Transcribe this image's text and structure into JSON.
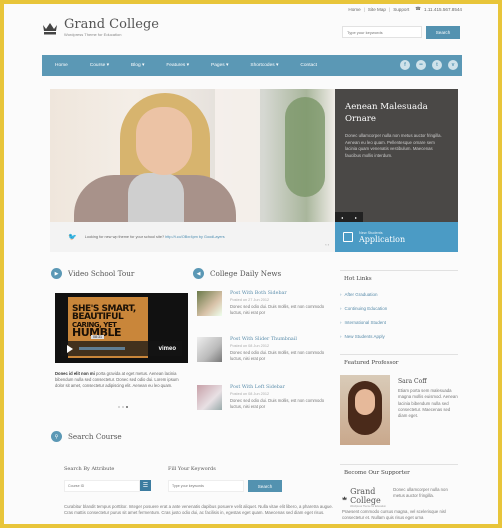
{
  "topbar": {
    "links": [
      "Home",
      "Site Map",
      "Support"
    ],
    "phone": "1.11.415.567.8544"
  },
  "logo": {
    "name": "Grand College",
    "tagline": "Wordpress Theme for Education"
  },
  "header_search": {
    "placeholder": "Type your keywords",
    "button": "Search"
  },
  "nav": {
    "items": [
      "Home",
      "Course ▾",
      "Blog ▾",
      "Features ▾",
      "Pages ▾",
      "Shortcodes ▾",
      "Contact"
    ],
    "social": [
      "facebook-icon",
      "flickr-icon",
      "twitter-icon",
      "vimeo-icon"
    ]
  },
  "slider": {
    "caption_title": "Aenean Malesuada Ornare",
    "caption_text": "Donec ullamcorper nulla non metus auctor fringilla. Aenean eu leo quam. Pellentesque ornare sem lacinia quam venenatis vestibulum. Maecenas faucibus mollis interdum.",
    "prev": "◂",
    "next": "▸"
  },
  "apply": {
    "small": "New Students",
    "big": "Application"
  },
  "tweet": {
    "text": "Looking for new wp theme for your school site?",
    "link": "http://t.co/OBxr4pm",
    "by": "by GoodLayers",
    "pager": "‹ ›"
  },
  "video_section": {
    "title": "Video School Tour",
    "screen_lines": [
      "SHE'S SMART,",
      "BEAUTIFUL",
      "CARING, YET",
      "HUMBLE"
    ],
    "time": "08:31",
    "brand": "vimeo",
    "text_bold": "Donec id elit non mi",
    "text": " porta gravida at eget metus. Aenean lacinia bibendum nulla sed consectetur. Donec sed odio dui. Lorem ipsum dolor sit amet, consectetur adipiscing elit. Aenean eu leo quam."
  },
  "news_section": {
    "title": "College Daily News",
    "posts": [
      {
        "title": "Post With Both Sidebar",
        "date": "Posted on 27 Jun 2012",
        "excerpt": "Donec sed odio dui. Duis mollis, est non commodo luctus, nisi erat por"
      },
      {
        "title": "Post With Slider Thumbnail",
        "date": "Posted on 08 Jun 2012",
        "excerpt": "Donec sed odio dui. Duis mollis, est non commodo luctus, nisi erat por"
      },
      {
        "title": "Post With Left Sidebar",
        "date": "Posted on 08 Jun 2012",
        "excerpt": "Donec sed odio dui. Duis mollis, est non commodo luctus, nisi erat por"
      }
    ]
  },
  "hot_links": {
    "title": "Hot Links",
    "items": [
      "After Graduation",
      "Continuing Education",
      "International Student",
      "New Students Apply"
    ]
  },
  "featured_professor": {
    "title": "Featured Professor",
    "name": "Sara Coff",
    "bio": "Etiam porta sem malesuada magna mollis euismod. Aenean lacinia bibendum nulla sed consectetur. Maecenas sed diam eget."
  },
  "supporters": {
    "title": "Become Our Supporter",
    "logo_name": "Grand College",
    "logo_tag": "Wordpress Theme for Education",
    "side_text": "Donec ullamcorper nulla non metus auctor fringilla.",
    "text": "Praesent commodo cursus magna, vel scelerisque nisl consectetur et. Nullam quis risus eget urna"
  },
  "course_search": {
    "title": "Search Course",
    "attr_label": "Search By Attribute",
    "attr_placeholder": "Course ID",
    "kw_label": "Fill Your Keywords",
    "kw_placeholder": "Type your keywords",
    "button": "Search",
    "text": "Curabitur blandit tempus porttitor. Integer posuere erat a ante venenatis dapibus posuere velit aliquet. Nulla vitae elit libero, a pharetra augue. Cras mattis consectetur purus sit amet fermentum. Cras justo odio dui, ac facilisis in, egestas eget quam. Maecenas sed diam eget risus."
  },
  "colors": {
    "accent": "#5b98b5",
    "apply": "#4b9bc5",
    "frame": "#e8c53a"
  }
}
